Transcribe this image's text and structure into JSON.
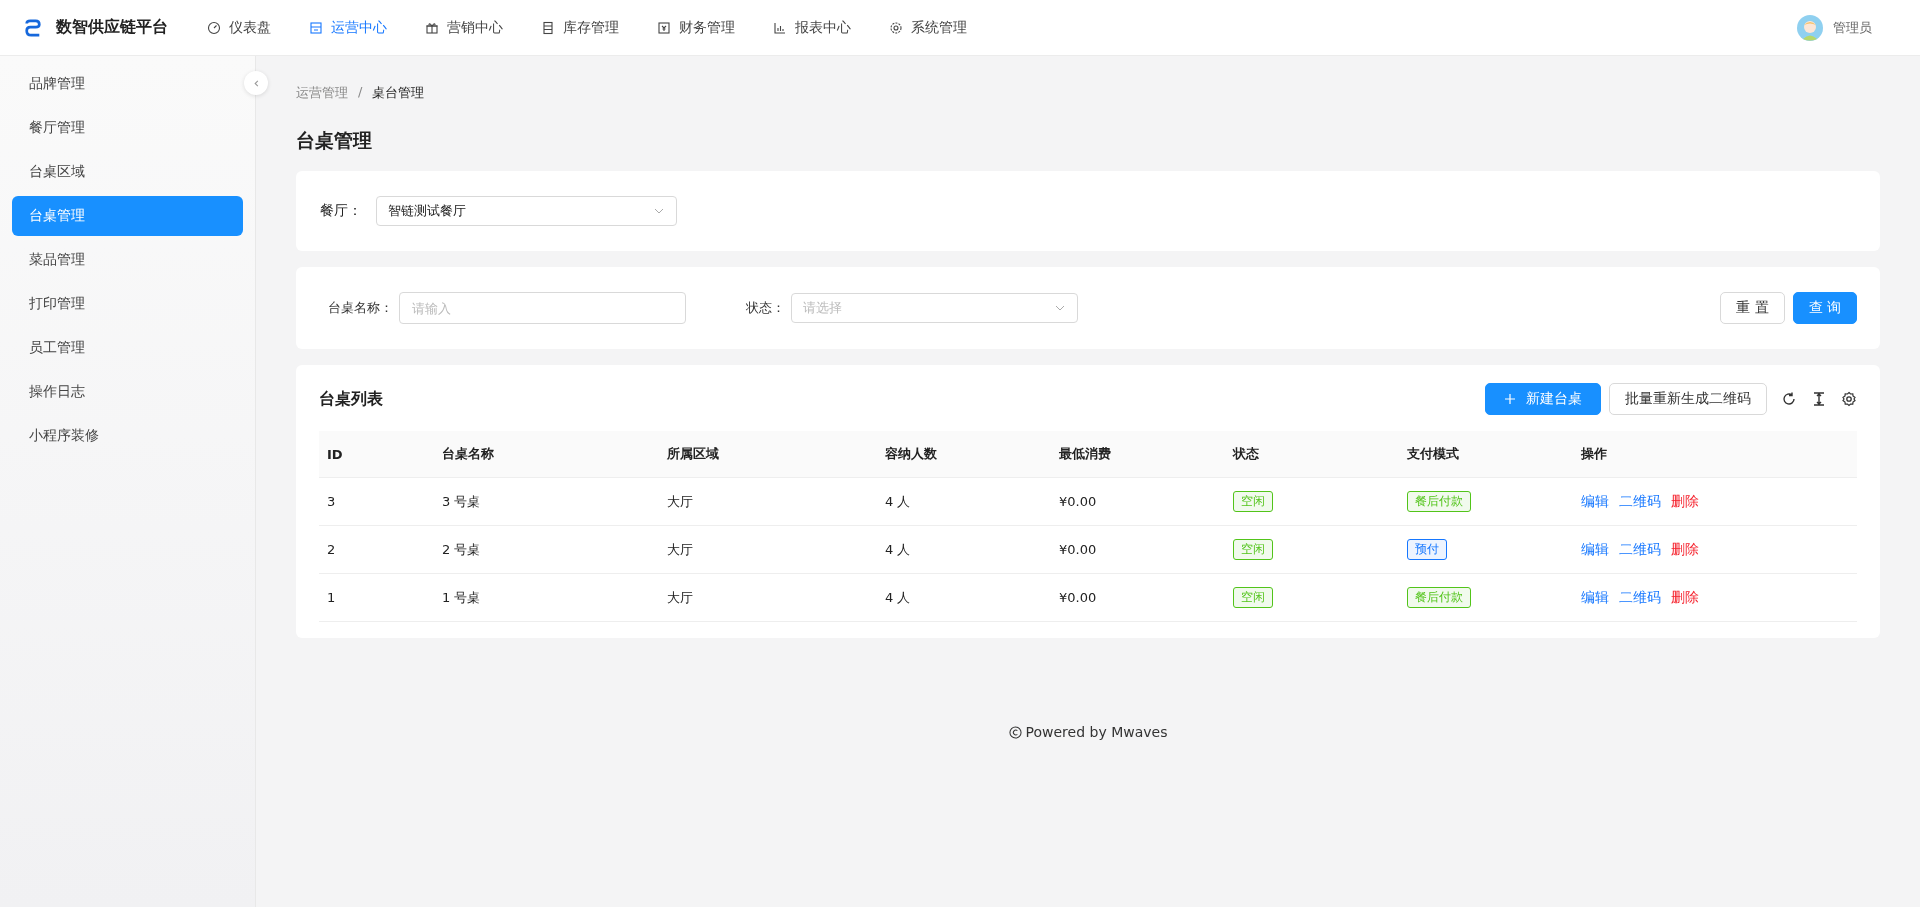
{
  "app": {
    "title": "数智供应链平台"
  },
  "nav": [
    {
      "label": "仪表盘",
      "selected": false
    },
    {
      "label": "运营中心",
      "selected": true
    },
    {
      "label": "营销中心",
      "selected": false
    },
    {
      "label": "库存管理",
      "selected": false
    },
    {
      "label": "财务管理",
      "selected": false
    },
    {
      "label": "报表中心",
      "selected": false
    },
    {
      "label": "系统管理",
      "selected": false
    }
  ],
  "user": {
    "name": "管理员"
  },
  "sidebar": {
    "items": [
      {
        "label": "品牌管理",
        "selected": false
      },
      {
        "label": "餐厅管理",
        "selected": false
      },
      {
        "label": "台桌区域",
        "selected": false
      },
      {
        "label": "台桌管理",
        "selected": true
      },
      {
        "label": "菜品管理",
        "selected": false
      },
      {
        "label": "打印管理",
        "selected": false
      },
      {
        "label": "员工管理",
        "selected": false
      },
      {
        "label": "操作日志",
        "selected": false
      },
      {
        "label": "小程序装修",
        "selected": false
      }
    ]
  },
  "breadcrumb": [
    "运营管理",
    "/",
    "桌台管理"
  ],
  "page_title": "台桌管理",
  "restaurant": {
    "label": "餐厅：",
    "value": "智链测试餐厅"
  },
  "filters": {
    "name_label": "台桌名称：",
    "name_placeholder": "请输入",
    "status_label": "状态：",
    "status_placeholder": "请选择",
    "reset": "重 置",
    "query": "查 询"
  },
  "table": {
    "title": "台桌列表",
    "new_button": "新建台桌",
    "batch_button": "批量重新生成二维码",
    "columns": [
      "ID",
      "台桌名称",
      "所属区域",
      "容纳人数",
      "最低消费",
      "状态",
      "支付模式",
      "操作"
    ],
    "rows": [
      {
        "id": "3",
        "name": "3 号桌",
        "area": "大厅",
        "capacity": "4 人",
        "min": "¥0.00",
        "status": {
          "text": "空闲",
          "color": "#52c41a"
        },
        "pay": {
          "text": "餐后付款",
          "color": "#52c41a"
        },
        "actions": [
          "编辑",
          "二维码",
          "删除"
        ]
      },
      {
        "id": "2",
        "name": "2 号桌",
        "area": "大厅",
        "capacity": "4 人",
        "min": "¥0.00",
        "status": {
          "text": "空闲",
          "color": "#52c41a"
        },
        "pay": {
          "text": "预付",
          "color": "#1677ff"
        },
        "actions": [
          "编辑",
          "二维码",
          "删除"
        ]
      },
      {
        "id": "1",
        "name": "1 号桌",
        "area": "大厅",
        "capacity": "4 人",
        "min": "¥0.00",
        "status": {
          "text": "空闲",
          "color": "#52c41a"
        },
        "pay": {
          "text": "餐后付款",
          "color": "#52c41a"
        },
        "actions": [
          "编辑",
          "二维码",
          "删除"
        ]
      }
    ]
  },
  "footer": "Powered by Mwaves"
}
